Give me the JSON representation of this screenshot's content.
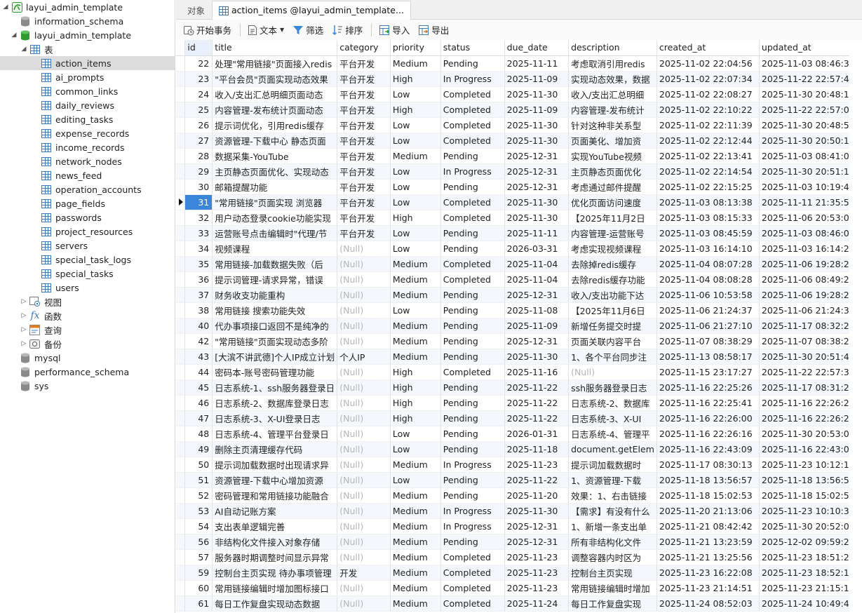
{
  "sidebar": {
    "connection": "layui_admin_template",
    "dbs_top": [
      "information_schema"
    ],
    "active_db": "layui_admin_template",
    "tables_group": "表",
    "tables": [
      "action_items",
      "ai_prompts",
      "common_links",
      "daily_reviews",
      "editing_tasks",
      "expense_records",
      "income_records",
      "network_nodes",
      "news_feed",
      "operation_accounts",
      "page_fields",
      "passwords",
      "project_resources",
      "servers",
      "special_task_logs",
      "special_tasks",
      "users"
    ],
    "selected_table": "action_items",
    "groups": [
      "视图",
      "函数",
      "查询",
      "备份"
    ],
    "dbs_bottom": [
      "mysql",
      "performance_schema",
      "sys"
    ]
  },
  "tabs": [
    "对象",
    "action_items @layui_admin_template..."
  ],
  "toolbar": {
    "begin_tx": "开始事务",
    "text": "文本",
    "filter": "筛选",
    "sort": "排序",
    "import": "导入",
    "export": "导出"
  },
  "columns": [
    "id",
    "title",
    "category",
    "priority",
    "status",
    "due_date",
    "description",
    "created_at",
    "updated_at"
  ],
  "null_text": "(Null)",
  "current_row_id": "31",
  "rows": [
    [
      "22",
      "处理\"常用链接\"页面接入redis",
      "平台开发",
      "Medium",
      "Pending",
      "2025-11-11",
      "考虑取消引用redis",
      "2025-11-02 22:04:56",
      "2025-11-03 08:46:36"
    ],
    [
      "23",
      "\"平台会员\"页面实现动态效果",
      "平台开发",
      "High",
      "In Progress",
      "2025-11-09",
      "实现动态效果，数据",
      "2025-11-02 22:07:34",
      "2025-11-22 22:57:44"
    ],
    [
      "24",
      "收入/支出汇总明细页面动态",
      "平台开发",
      "Low",
      "Completed",
      "2025-11-30",
      "收入/支出汇总明细",
      "2025-11-02 22:08:27",
      "2025-11-30 20:48:13"
    ],
    [
      "25",
      "内容管理-发布统计页面动态",
      "平台开发",
      "High",
      "Completed",
      "2025-11-09",
      "内容管理-发布统计",
      "2025-11-02 22:10:22",
      "2025-11-22 22:57:06"
    ],
    [
      "26",
      "提示词优化，引用redis缓存",
      "平台开发",
      "Low",
      "Completed",
      "2025-11-30",
      "针对这种非关系型",
      "2025-11-02 22:11:39",
      "2025-11-30 20:48:57"
    ],
    [
      "27",
      "资源管理-下载中心 静态页面",
      "平台开发",
      "Low",
      "Completed",
      "2025-11-30",
      "页面美化、增加资",
      "2025-11-02 22:12:44",
      "2025-11-30 20:50:12"
    ],
    [
      "28",
      "数据采集-YouTube",
      "平台开发",
      "Medium",
      "Pending",
      "2025-12-31",
      "实现YouTube视频",
      "2025-11-02 22:13:41",
      "2025-11-03 08:41:03"
    ],
    [
      "29",
      "主页静态页面优化、实现动态",
      "平台开发",
      "Low",
      "In Progress",
      "2025-12-31",
      "主页静态页面优化",
      "2025-11-02 22:14:54",
      "2025-11-30 20:51:12"
    ],
    [
      "30",
      "邮箱提醒功能",
      "平台开发",
      "Low",
      "Pending",
      "2025-12-31",
      "考虑通过邮件提醒",
      "2025-11-02 22:15:25",
      "2025-11-03 10:19:49"
    ],
    [
      "31",
      "\"常用链接\"页面实现 浏览器",
      "平台开发",
      "Low",
      "Completed",
      "2025-11-30",
      "优化页面访问速度",
      "2025-11-03 08:13:38",
      "2025-11-11 21:35:52"
    ],
    [
      "32",
      "用户动态登录cookie功能实现",
      "平台开发",
      "High",
      "Completed",
      "2025-11-30",
      "【2025年11月2日",
      "2025-11-03 08:15:33",
      "2025-11-06 20:53:07"
    ],
    [
      "33",
      "运营账号点击编辑时\"代理/节",
      "平台开发",
      "Low",
      "Pending",
      "2025-11-11",
      "内容管理-运营账号",
      "2025-11-03 08:45:59",
      "2025-11-03 08:46:05"
    ],
    [
      "34",
      "视频课程",
      null,
      "Low",
      "Pending",
      "2026-03-31",
      "考虑实现视频课程",
      "2025-11-03 16:14:10",
      "2025-11-03 16:14:21"
    ],
    [
      "35",
      "常用链接-加载数据失败（后",
      null,
      "Medium",
      "Completed",
      "2025-11-04",
      "去除掉redis缓存",
      "2025-11-04 08:07:28",
      "2025-11-06 19:28:28"
    ],
    [
      "36",
      "提示词管理-请求异常，错误",
      null,
      "Medium",
      "Completed",
      "2025-11-04",
      "去除redis缓存功能",
      "2025-11-04 08:08:28",
      "2025-11-06 08:49:22"
    ],
    [
      "37",
      "财务收支功能重构",
      null,
      "Medium",
      "Pending",
      "2025-12-31",
      "收入/支出功能下达",
      "2025-11-06 10:53:58",
      "2025-11-06 19:28:22"
    ],
    [
      "38",
      "常用链接 搜索功能失效",
      null,
      "Low",
      "Pending",
      "2025-11-08",
      "【2025年11月6日",
      "2025-11-06 21:24:37",
      "2025-11-06 21:24:37"
    ],
    [
      "40",
      "代办事项接口返回不是纯净的",
      null,
      "Medium",
      "Pending",
      "2025-11-09",
      "新增任务提交时提",
      "2025-11-06 21:27:10",
      "2025-11-17 08:32:24"
    ],
    [
      "42",
      "\"常用链接\"页面实现动态多阶",
      null,
      "Medium",
      "Pending",
      "2025-12-31",
      "页面关联内容平台",
      "2025-11-07 08:38:29",
      "2025-11-07 08:38:29"
    ],
    [
      "43",
      "[大滨不讲武德]个人IP成立计划",
      "个人IP",
      "Medium",
      "Pending",
      "2025-11-30",
      "1、各个平台同步注",
      "2025-11-13 08:58:17",
      "2025-11-30 20:51:48"
    ],
    [
      "44",
      "密码本-账号密码管理功能",
      null,
      "High",
      "Completed",
      "2025-11-16",
      null,
      "2025-11-15 23:17:27",
      "2025-11-22 22:57:38"
    ],
    [
      "45",
      "日志系统-1、ssh服务器登录日",
      null,
      "High",
      "Pending",
      "2025-11-22",
      "ssh服务器登录日志",
      "2025-11-16 22:25:26",
      "2025-11-17 08:31:29"
    ],
    [
      "46",
      "日志系统-2、数据库登录日志",
      null,
      "High",
      "Pending",
      "2025-11-22",
      "日志系统-2、数据库",
      "2025-11-16 22:25:41",
      "2025-11-16 22:26:24"
    ],
    [
      "47",
      "日志系统-3、X-UI登录日志",
      null,
      "High",
      "Pending",
      "2025-11-22",
      "日志系统-3、X-UI",
      "2025-11-16 22:26:00",
      "2025-11-16 22:26:29"
    ],
    [
      "48",
      "日志系统-4、管理平台登录日",
      null,
      "Low",
      "Pending",
      "2026-01-31",
      "日志系统-4、管理平",
      "2025-11-16 22:26:16",
      "2025-11-30 20:53:08"
    ],
    [
      "49",
      "删除主页清理缓存代码",
      null,
      "Low",
      "Pending",
      "2025-11-18",
      "document.getElem",
      "2025-11-16 22:43:09",
      "2025-11-16 22:43:09"
    ],
    [
      "50",
      "提示词加载数据时出现请求异",
      null,
      "Medium",
      "In Progress",
      "2025-11-23",
      "提示词加载数据时",
      "2025-11-17 08:30:13",
      "2025-11-23 10:12:14"
    ],
    [
      "51",
      "资源管理-下载中心增加资源",
      null,
      "Low",
      "Pending",
      "2025-11-22",
      "1、资源管理-下载",
      "2025-11-18 13:56:57",
      "2025-11-18 13:56:57"
    ],
    [
      "52",
      "密码管理和常用链接功能融合",
      null,
      "Medium",
      "Pending",
      "2025-11-20",
      "效果：1、右击链接",
      "2025-11-18 15:02:53",
      "2025-11-18 15:02:53"
    ],
    [
      "53",
      "AI自动记账方案",
      null,
      "Medium",
      "In Progress",
      "2025-11-30",
      "【需求】有没有什么",
      "2025-11-20 21:13:06",
      "2025-11-23 10:10:39"
    ],
    [
      "54",
      "支出表单逻辑完善",
      null,
      "Medium",
      "In Progress",
      "2025-12-31",
      "1、新增一条支出单",
      "2025-11-21 08:42:42",
      "2025-11-30 20:52:00"
    ],
    [
      "56",
      "非结构化文件接入对象存储",
      null,
      "Medium",
      "Pending",
      "2025-12-31",
      "所有非结构化文件",
      "2025-11-21 13:23:59",
      "2025-12-02 09:59:22"
    ],
    [
      "57",
      "服务器时期调整时间显示异常",
      null,
      "Medium",
      "Completed",
      "2025-11-23",
      "调整容器内时区为",
      "2025-11-21 13:25:56",
      "2025-11-23 18:51:29"
    ],
    [
      "59",
      "控制台主页实现 待办事项管理",
      "开发",
      "Medium",
      "Completed",
      "2025-11-23",
      "控制台主页实现",
      "2025-11-23 16:22:08",
      "2025-11-23 18:52:10"
    ],
    [
      "60",
      "常用链接编辑时增加图标接口",
      null,
      "Medium",
      "Completed",
      "2025-11-23",
      "常用链接编辑时增加",
      "2025-11-23 21:14:51",
      "2025-11-23 21:15:11"
    ],
    [
      "61",
      "每日工作复盘实现动态数据",
      null,
      "Medium",
      "Completed",
      "2025-11-24",
      "每日工作复盘实现",
      "2025-11-24 08:52:03",
      "2025-11-24 10:49:43"
    ]
  ],
  "colors": {
    "accent": "#3b86d9",
    "stripe": "#f4f8fd",
    "null": "#b5b5b5",
    "db_green": "#2e9b2e"
  }
}
